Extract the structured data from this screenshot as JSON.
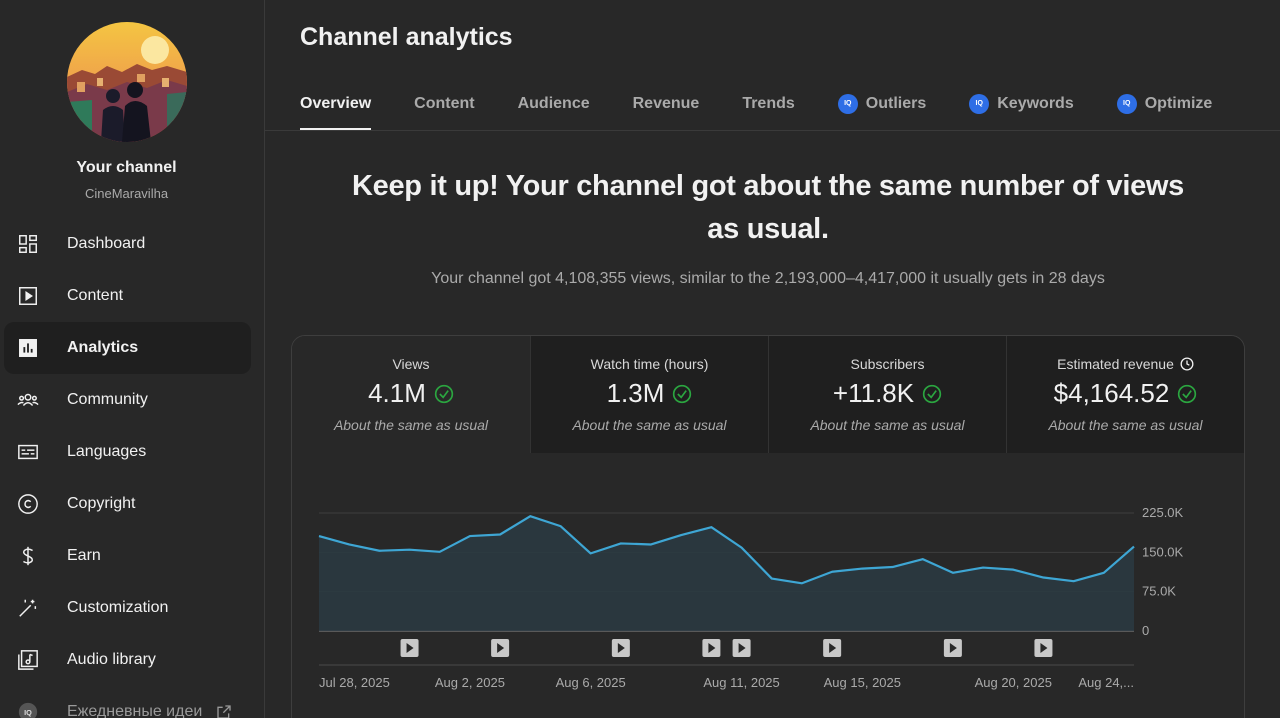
{
  "sidebar": {
    "channel_title": "Your channel",
    "channel_handle": "CineMaravilha",
    "items": [
      {
        "label": "Dashboard",
        "icon": "dashboard-icon",
        "active": false
      },
      {
        "label": "Content",
        "icon": "content-icon",
        "active": false
      },
      {
        "label": "Analytics",
        "icon": "analytics-icon",
        "active": true
      },
      {
        "label": "Community",
        "icon": "community-icon",
        "active": false
      },
      {
        "label": "Languages",
        "icon": "languages-icon",
        "active": false
      },
      {
        "label": "Copyright",
        "icon": "copyright-icon",
        "active": false
      },
      {
        "label": "Earn",
        "icon": "dollar-icon",
        "active": false
      },
      {
        "label": "Customization",
        "icon": "magic-wand-icon",
        "active": false
      },
      {
        "label": "Audio library",
        "icon": "audio-library-icon",
        "active": false
      },
      {
        "label": "Ежедневные идеи",
        "icon": "iq-icon",
        "active": false
      }
    ]
  },
  "header": {
    "title": "Channel analytics",
    "tabs": [
      {
        "label": "Overview",
        "active": true
      },
      {
        "label": "Content"
      },
      {
        "label": "Audience"
      },
      {
        "label": "Revenue"
      },
      {
        "label": "Trends"
      },
      {
        "label": "Outliers",
        "badge": "IQ"
      },
      {
        "label": "Keywords",
        "badge": "IQ"
      },
      {
        "label": "Optimize",
        "badge": "IQ"
      }
    ]
  },
  "summary": {
    "headline": "Keep it up! Your channel got about the same number of views as usual.",
    "subline": "Your channel got 4,108,355 views, similar to the 2,193,000–4,417,000 it usually gets in 28 days"
  },
  "metrics": [
    {
      "label": "Views",
      "value": "4.1M",
      "note": "About the same as usual",
      "active": true
    },
    {
      "label": "Watch time (hours)",
      "value": "1.3M",
      "note": "About the same as usual"
    },
    {
      "label": "Subscribers",
      "value": "+11.8K",
      "note": "About the same as usual"
    },
    {
      "label": "Estimated revenue",
      "value": "$4,164.52",
      "note": "About the same as usual",
      "has_clock": true
    }
  ],
  "colors": {
    "line": "#3ea6d4",
    "fill": "#2a3a42",
    "check": "#2ba640",
    "badge": "#2e6ee6"
  },
  "chart_data": {
    "type": "area",
    "x": [
      "Jul 28",
      "Jul 29",
      "Jul 30",
      "Jul 31",
      "Aug 1",
      "Aug 2",
      "Aug 3",
      "Aug 4",
      "Aug 5",
      "Aug 6",
      "Aug 7",
      "Aug 8",
      "Aug 9",
      "Aug 10",
      "Aug 11",
      "Aug 12",
      "Aug 13",
      "Aug 14",
      "Aug 15",
      "Aug 16",
      "Aug 17",
      "Aug 18",
      "Aug 19",
      "Aug 20",
      "Aug 21",
      "Aug 22",
      "Aug 23",
      "Aug 24"
    ],
    "values": [
      181000,
      165000,
      153000,
      155000,
      151000,
      181000,
      184000,
      219000,
      200000,
      148000,
      167000,
      165000,
      183000,
      198000,
      159000,
      100000,
      91000,
      113000,
      119000,
      122000,
      137000,
      111000,
      121000,
      117000,
      102000,
      95000,
      111000,
      161000
    ],
    "ylim": [
      0,
      225000
    ],
    "y_ticks": [
      "225.0K",
      "150.0K",
      "75.0K",
      "0"
    ],
    "y_tick_values": [
      225000,
      150000,
      75000,
      0
    ],
    "x_tick_labels": [
      {
        "label": "Jul 28, 2025",
        "index": 0
      },
      {
        "label": "Aug 2, 2025",
        "index": 5
      },
      {
        "label": "Aug 6, 2025",
        "index": 9
      },
      {
        "label": "Aug 11, 2025",
        "index": 14
      },
      {
        "label": "Aug 15, 2025",
        "index": 18
      },
      {
        "label": "Aug 20, 2025",
        "index": 23
      },
      {
        "label": "Aug 24,...",
        "index": 27
      }
    ],
    "video_marker_indices": [
      3,
      6,
      10,
      13,
      14,
      17,
      21,
      24
    ],
    "grid": true
  }
}
